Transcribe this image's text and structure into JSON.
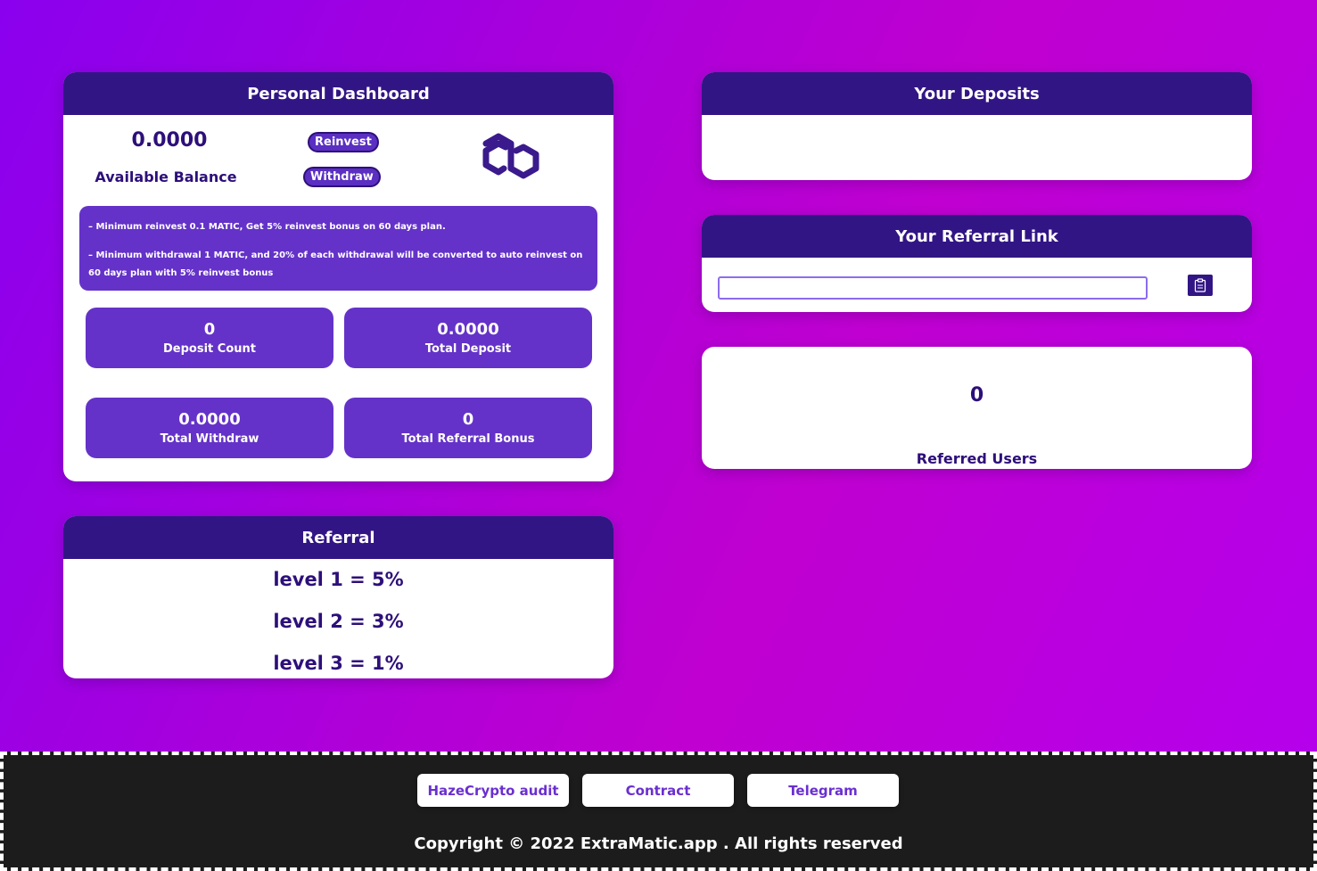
{
  "dashboard": {
    "title": "Personal Dashboard",
    "balance_value": "0.0000",
    "balance_label": "Available Balance",
    "reinvest_label": "Reinvest",
    "withdraw_label": "Withdraw",
    "logo_icon": "polygon-matic-icon",
    "info": [
      "– Minimum reinvest 0.1 MATIC, Get 5% reinvest bonus on 60 days plan.",
      "– Minimum withdrawal 1 MATIC, and 20% of each withdrawal will be converted to auto reinvest on 60 days plan with 5% reinvest bonus"
    ],
    "stats": [
      {
        "value": "0",
        "label": "Deposit Count"
      },
      {
        "value": "0.0000",
        "label": "Total Deposit"
      },
      {
        "value": "0.0000",
        "label": "Total Withdraw"
      },
      {
        "value": "0",
        "label": "Total Referral Bonus"
      }
    ]
  },
  "referral": {
    "title": "Referral",
    "levels": [
      "level 1 = 5%",
      "level 2 = 3%",
      "level 3 = 1%"
    ]
  },
  "deposits": {
    "title": "Your Deposits"
  },
  "ref_link": {
    "title": "Your Referral Link",
    "value": "",
    "copy_icon": "clipboard-icon"
  },
  "referred_users": {
    "count": "0",
    "label": "Referred Users"
  },
  "footer": {
    "buttons": [
      "HazeCrypto audit",
      "Contract",
      "Telegram"
    ],
    "copyright": "Copyright © 2022 ExtraMatic.app . All rights reserved"
  },
  "colors": {
    "header": "#321585",
    "stat_box": "#6432c8",
    "text_dark": "#2d0f7a"
  }
}
